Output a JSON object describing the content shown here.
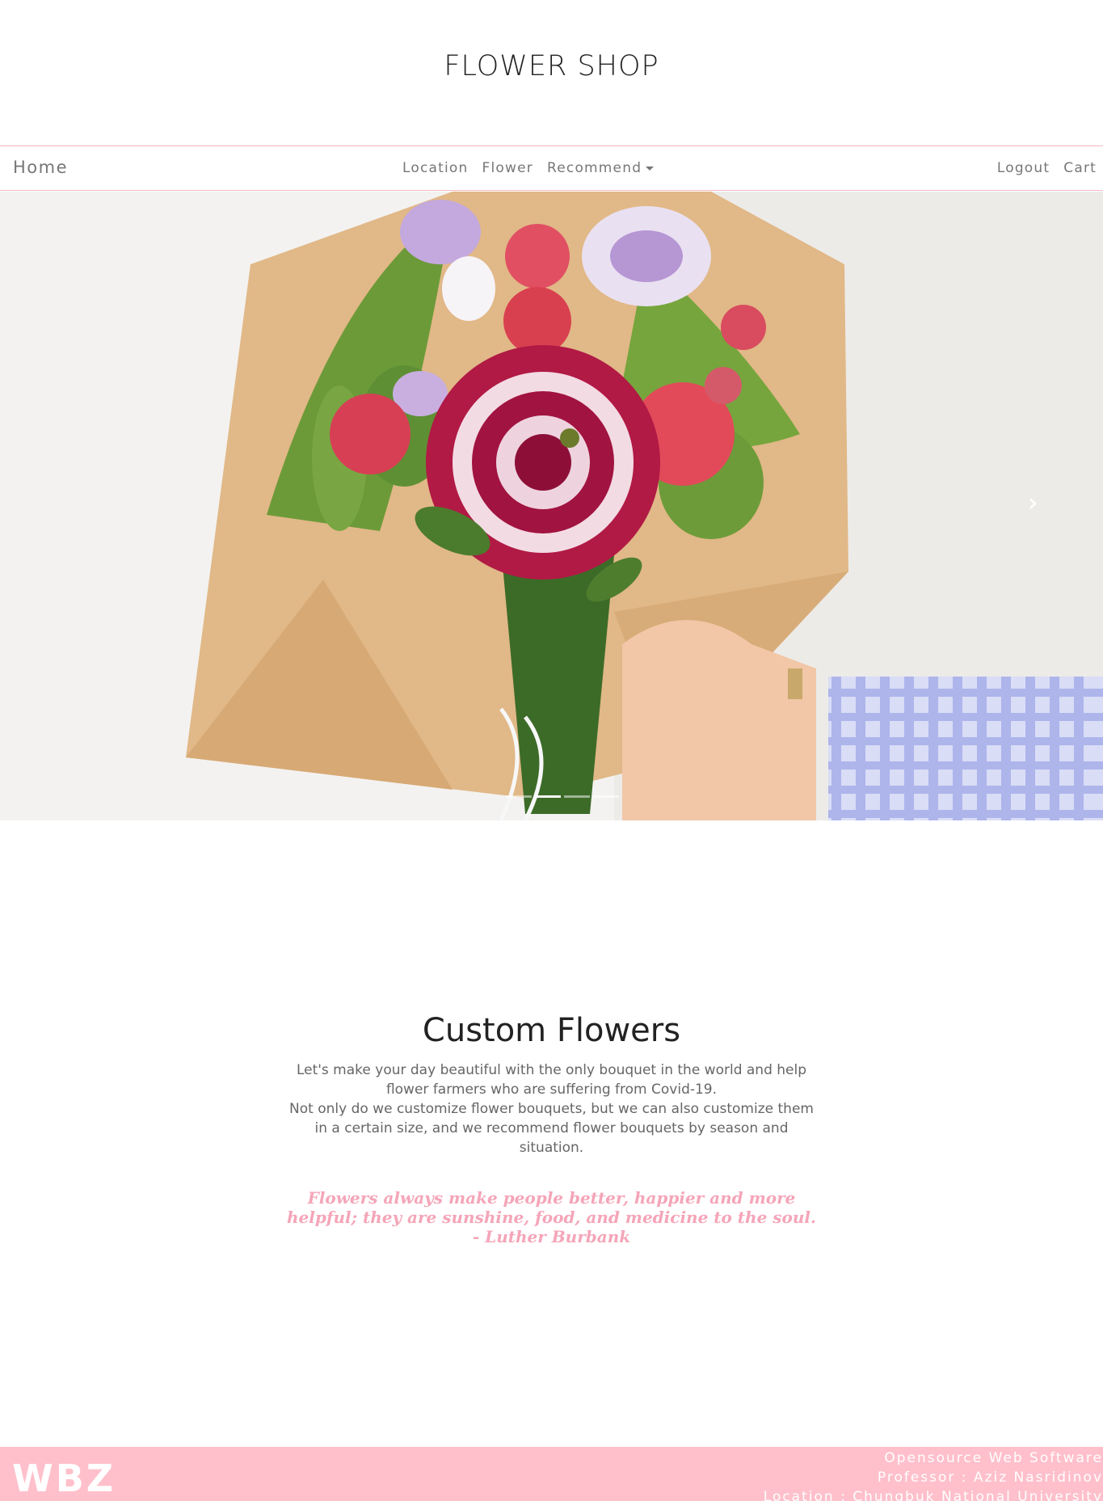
{
  "brand": {
    "title": "FLOWER SHOP"
  },
  "nav": {
    "home": "Home",
    "location": "Location",
    "flower": "Flower",
    "recommend": "Recommend",
    "logout": "Logout",
    "cart": "Cart"
  },
  "hero": {
    "next_icon": "chevron-right-icon",
    "slides_count": 4,
    "active_slide": 2
  },
  "section": {
    "heading": "Custom Flowers",
    "desc1": "Let's make your day beautiful with the only bouquet in the world and help flower farmers who are suffering from Covid-19.",
    "desc2": "Not only do we customize flower bouquets, but we can also customize them in a certain size, and we recommend flower bouquets by season and situation.",
    "quote": "Flowers always make people better, happier and more helpful; they are sunshine, food, and medicine to the soul.",
    "quote_author": "- Luther Burbank"
  },
  "footer": {
    "logo": "WBZ",
    "line1": "Opensource Web Software",
    "line2": "Professor : Aziz Nasridinov",
    "line3": "Location : Chungbuk National University"
  },
  "colors": {
    "accent": "#ffc0cb",
    "quote": "#f5a5b8",
    "nav_border": "#f4b8c3"
  }
}
